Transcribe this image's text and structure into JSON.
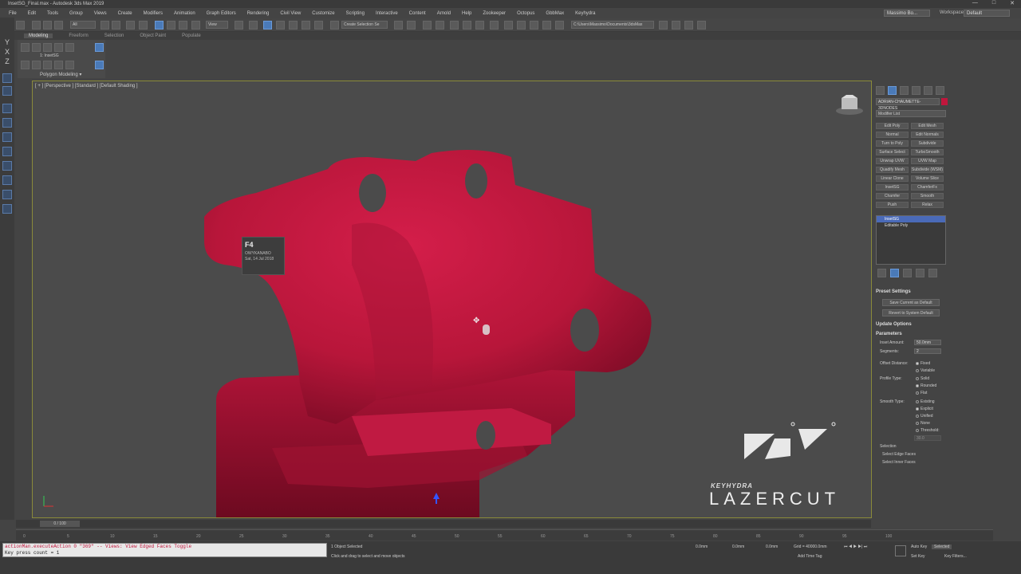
{
  "window": {
    "title": "InsetSG_Final.max - Autodesk 3ds Max 2019",
    "controls": [
      "—",
      "□",
      "✕"
    ]
  },
  "menu": [
    "File",
    "Edit",
    "Tools",
    "Group",
    "Views",
    "Create",
    "Modifiers",
    "Animation",
    "Graph Editors",
    "Rendering",
    "Civil View",
    "Customize",
    "Scripting",
    "Interactive",
    "Content",
    "Arnold",
    "Help",
    "Zookeeper",
    "Octopus",
    "GbbMax",
    "Keyhydra"
  ],
  "user": {
    "name": "Massimo Bo...",
    "workspaces_label": "Workspaces:",
    "workspace": "Default"
  },
  "toolbar": {
    "filter": "All",
    "view": "View",
    "selection_set": "Create Selection Se",
    "path": "C:\\Users\\Massimo\\Documents\\3dsMax"
  },
  "ribbon": {
    "tabs": [
      "Modeling",
      "Freeform",
      "Selection",
      "Object Paint",
      "Populate"
    ],
    "active": "Modeling",
    "sub_label": "1: InsetSG",
    "panel_label": "Polygon Modeling ▾"
  },
  "left_strip": {
    "axes": [
      "Y",
      "X",
      "Z"
    ]
  },
  "viewport": {
    "label": "[ + ] [Perspective ] [Standard ] [Default Shading ]",
    "tooltip": {
      "key": "F4",
      "user": "OWYKANABO",
      "date": "Sat, 14 Jul 2018"
    },
    "brand_sub": "KEYHYDRA",
    "brand": "LAZERCUT",
    "object_color": "#c0163c"
  },
  "command_panel": {
    "object_name": "ADRIAN-CHAUMETTE-3DNODES",
    "modifier_list": "Modifier List",
    "modifiers": [
      [
        "Edit Poly",
        "Edit Mesh"
      ],
      [
        "Normal",
        "Edit Normals"
      ],
      [
        "Turn to Poly",
        "Subdivide"
      ],
      [
        "Surface Select",
        "TurboSmooth"
      ],
      [
        "Unwrap UVW",
        "UVW Map"
      ],
      [
        "Quadify Mesh",
        "Subdivide (WSM)"
      ],
      [
        "Linear Clone",
        "Volume Slice"
      ],
      [
        "InsetSG",
        "ChamferFx"
      ],
      [
        "Chamfer",
        "Smooth"
      ],
      [
        "Push",
        "Relax"
      ]
    ],
    "stack": [
      "InsetSG",
      "Editable Poly"
    ],
    "preset_settings": "Preset Settings",
    "save_default": "Save Current as Default",
    "revert_default": "Revert to System Default",
    "update_options": "Update Options",
    "parameters": "Parameters",
    "inset_amount_label": "Inset Amount:",
    "inset_amount": "50.0mm",
    "segments_label": "Segments:",
    "segments": "2",
    "offset_label": "Offset Distance:",
    "offset_options": [
      "Fixed",
      "Variable"
    ],
    "profile_label": "Profile Type:",
    "profile_options": [
      "Solid",
      "Rounded",
      "Flat"
    ],
    "smooth_label": "Smooth Type:",
    "smooth_options": [
      "Existing",
      "Explicit",
      "Unified",
      "None",
      "Threshold:"
    ],
    "threshold": "30.0",
    "selection_label": "Selection",
    "select_edge": "Select Edge Faces",
    "select_inner": "Select Inner Faces"
  },
  "timeline": {
    "frame": "0 / 100",
    "ticks": [
      "0",
      "5",
      "10",
      "15",
      "20",
      "25",
      "30",
      "35",
      "40",
      "45",
      "50",
      "55",
      "60",
      "65",
      "70",
      "75",
      "80",
      "85",
      "90",
      "95",
      "100"
    ]
  },
  "status": {
    "script_line1": "actionMan.executeAction 0 \"369\"  -- Views: View Edged Faces Toggle",
    "script_line2": "Key press count = 1",
    "selected": "1 Object Selected",
    "hint": "Click and drag to select and move objects",
    "x": "0.0mm",
    "y": "0.0mm",
    "z": "0.0mm",
    "grid": "Grid = 40000.0mm",
    "add_time_tag": "Add Time Tag",
    "auto_key": "Auto Key",
    "selected_mode": "Selected",
    "set_key": "Set Key",
    "key_filters": "Key Filters..."
  }
}
